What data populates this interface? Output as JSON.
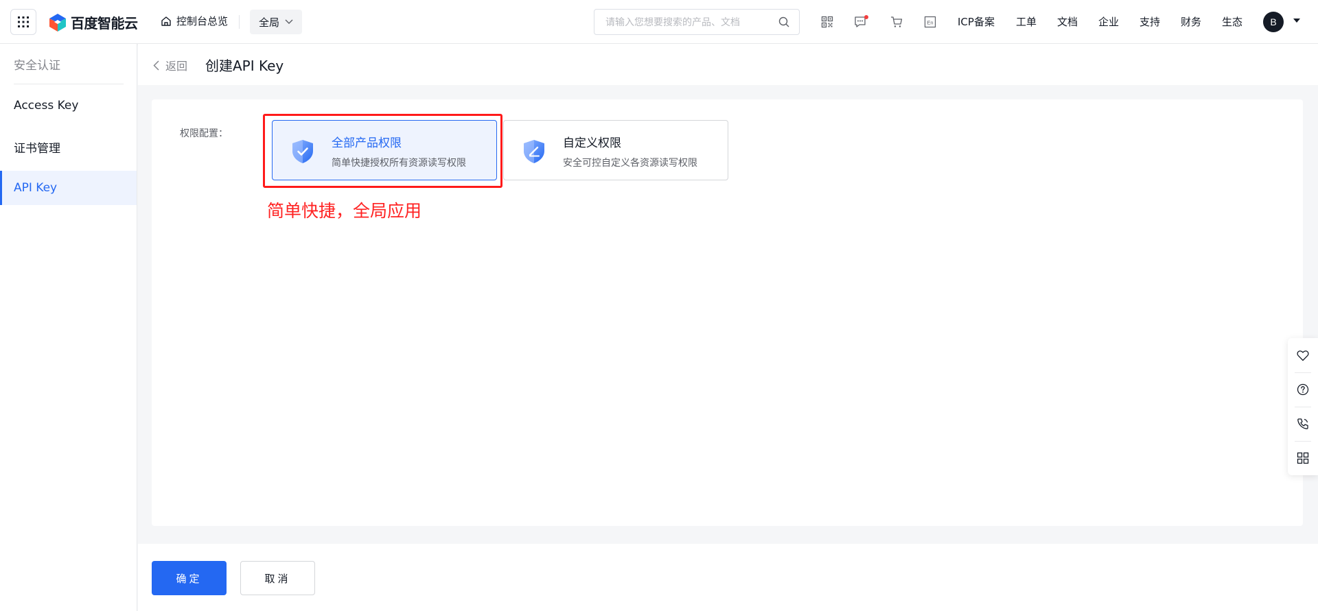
{
  "colors": {
    "primary": "#2468f2",
    "annotation": "#ff1a1a",
    "text": "#151b26",
    "muted": "#84868c"
  },
  "topbar": {
    "brand": "百度智能云",
    "console_label": "控制台总览",
    "region": "全局",
    "search_placeholder": "请输入您想要搜索的产品、文档",
    "icons": [
      "qrcode-icon",
      "message-icon",
      "cart-icon",
      "language-en-icon"
    ],
    "lang_label": "En",
    "links": [
      "ICP备案",
      "工单",
      "文档",
      "企业",
      "支持",
      "财务",
      "生态"
    ],
    "avatar": "B"
  },
  "sidebar": {
    "title": "安全认证",
    "items": [
      {
        "label": "Access Key",
        "active": false
      },
      {
        "label": "证书管理",
        "active": false
      },
      {
        "label": "API Key",
        "active": true
      }
    ]
  },
  "header": {
    "back_label": "返回",
    "title": "创建API Key"
  },
  "form": {
    "perm_label": "权限配置：",
    "options": [
      {
        "title": "全部产品权限",
        "desc": "简单快捷授权所有资源读写权限",
        "selected": true,
        "icon": "shield-check-icon"
      },
      {
        "title": "自定义权限",
        "desc": "安全可控自定义各资源读写权限",
        "selected": false,
        "icon": "shield-edit-icon"
      }
    ],
    "annotation": "简单快捷，全局应用"
  },
  "footer": {
    "confirm": "确定",
    "cancel": "取消"
  },
  "float_bar": [
    "heart-icon",
    "help-icon",
    "phone-icon",
    "apps-icon"
  ]
}
